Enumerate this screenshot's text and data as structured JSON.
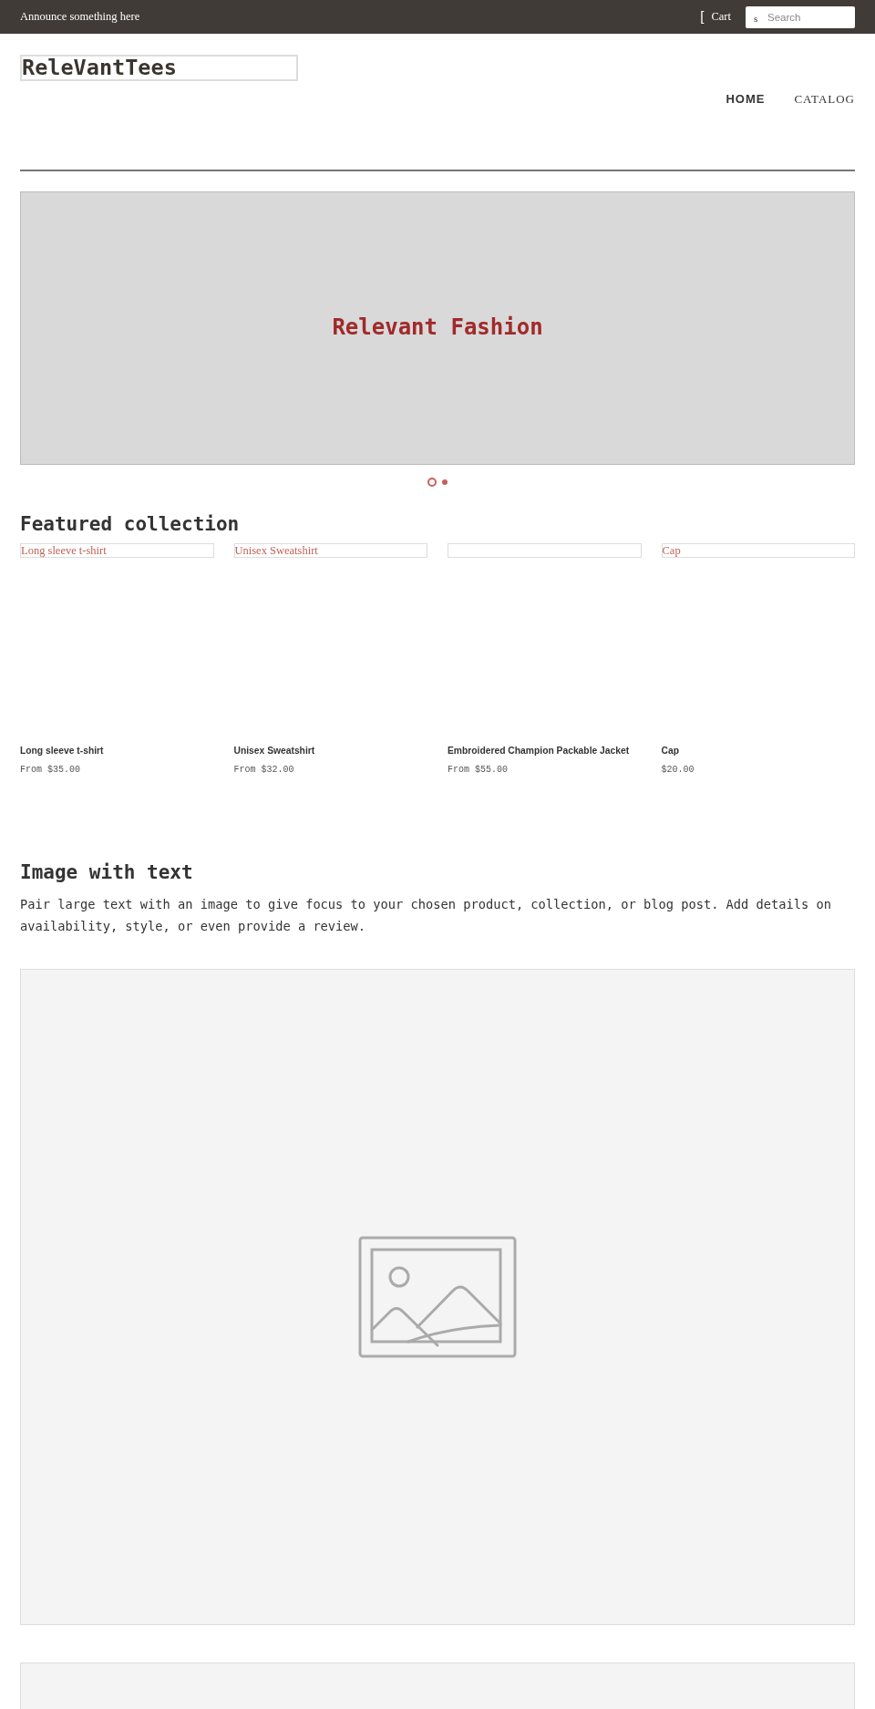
{
  "announcement": {
    "text": "Announce something here"
  },
  "header_links": {
    "cart_icon": "[",
    "cart": "Cart",
    "search_icon": "s",
    "search_placeholder": "Search"
  },
  "logo": "ReleVantTees",
  "nav": [
    {
      "label": "HOME",
      "selected": true
    },
    {
      "label": "CATALOG",
      "selected": false
    }
  ],
  "slideshow": {
    "title": "Relevant Fashion",
    "dots": [
      {
        "selected": true
      },
      {
        "selected": false
      }
    ]
  },
  "featured": {
    "title": "Featured collection",
    "products": [
      {
        "image_alt": "Long sleeve t-shirt",
        "name": "Long sleeve t-shirt",
        "price": "From $35.00"
      },
      {
        "image_alt": "Unisex Sweatshirt",
        "name": "Unisex Sweatshirt",
        "price": "From $32.00"
      },
      {
        "name": "Embroidered Champion Packable Jacket",
        "price": "From $55.00"
      },
      {
        "image_alt": "Cap",
        "name": "Cap",
        "price": "$20.00"
      }
    ]
  },
  "image_with_text": {
    "title": "Image with text",
    "body": "Pair large text with an image to give focus to your chosen product, collection, or blog post. Add details on availability, style, or even provide a review."
  }
}
